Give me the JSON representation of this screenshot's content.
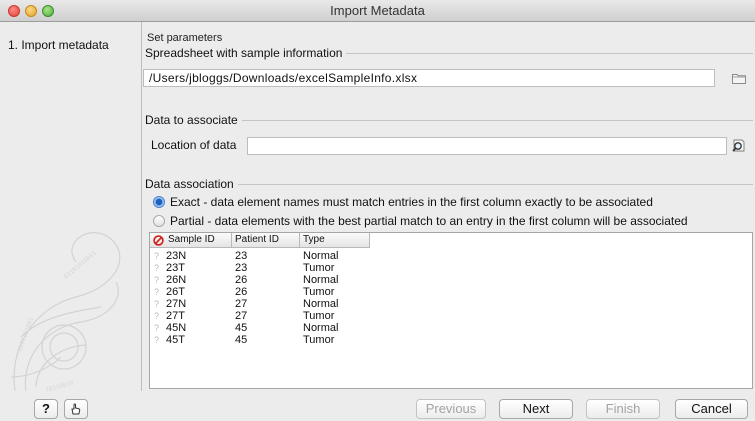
{
  "window": {
    "title": "Import Metadata"
  },
  "sidebar": {
    "steps": [
      {
        "label": "1.  Import metadata"
      }
    ]
  },
  "main": {
    "header": "Set parameters",
    "spreadsheet_group": {
      "legend": "Spreadsheet with sample information",
      "path_value": "/Users/jbloggs/Downloads/excelSampleInfo.xlsx",
      "browse_icon": "folder-icon"
    },
    "data_group": {
      "legend": "Data to associate",
      "location_label": "Location of data",
      "location_value": "",
      "browse_icon": "browse-icon"
    },
    "association_group": {
      "legend": "Data association",
      "options": [
        {
          "label": "Exact - data element names must match entries in the first column exactly to be associated",
          "selected": true
        },
        {
          "label": "Partial - data elements with the best partial match to an entry in the first column will be associated",
          "selected": false
        }
      ]
    },
    "table": {
      "columns": [
        "Sample ID",
        "Patient ID",
        "Type"
      ],
      "rows": [
        {
          "sample_id": "23N",
          "patient_id": "23",
          "type": "Normal"
        },
        {
          "sample_id": "23T",
          "patient_id": "23",
          "type": "Tumor"
        },
        {
          "sample_id": "26N",
          "patient_id": "26",
          "type": "Normal"
        },
        {
          "sample_id": "26T",
          "patient_id": "26",
          "type": "Tumor"
        },
        {
          "sample_id": "27N",
          "patient_id": "27",
          "type": "Normal"
        },
        {
          "sample_id": "27T",
          "patient_id": "27",
          "type": "Tumor"
        },
        {
          "sample_id": "45N",
          "patient_id": "45",
          "type": "Normal"
        },
        {
          "sample_id": "45T",
          "patient_id": "45",
          "type": "Tumor"
        }
      ],
      "unmatched_marker": "?"
    }
  },
  "buttons": {
    "help": "?",
    "previous": "Previous",
    "next": "Next",
    "finish": "Finish",
    "cancel": "Cancel"
  },
  "colors": {
    "radio_selected": "#1d5fbd",
    "error_icon": "#d0221a"
  }
}
